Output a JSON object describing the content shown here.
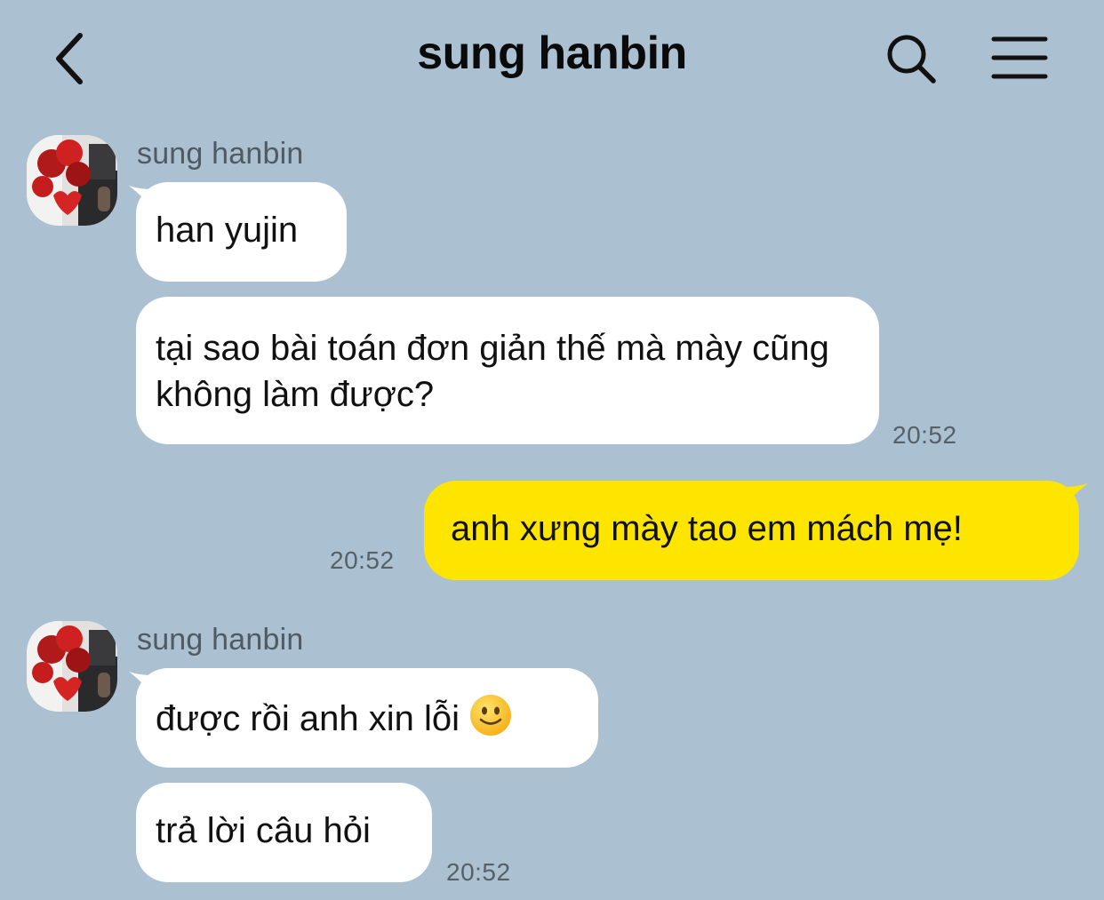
{
  "header": {
    "title": "sung hanbin",
    "back_icon": "chevron-left-icon",
    "search_icon": "search-icon",
    "menu_icon": "hamburger-menu-icon"
  },
  "colors": {
    "background": "#abc1d1",
    "incoming_bubble": "#ffffff",
    "outgoing_bubble": "#fee500"
  },
  "messages": {
    "group1": {
      "sender": "sung hanbin",
      "bubble1": "han yujin",
      "bubble2": "tại sao bài toán đơn giản thế mà mày cũng không làm được?",
      "time": "20:52"
    },
    "mine1": {
      "text": "anh xưng mày tao em mách mẹ!",
      "time": "20:52"
    },
    "group2": {
      "sender": "sung hanbin",
      "bubble1": "được rồi anh xin lỗi",
      "bubble1_emoji": "slightly-smiling-face-emoji",
      "bubble2": "trả lời câu hỏi",
      "time": "20:52"
    }
  }
}
